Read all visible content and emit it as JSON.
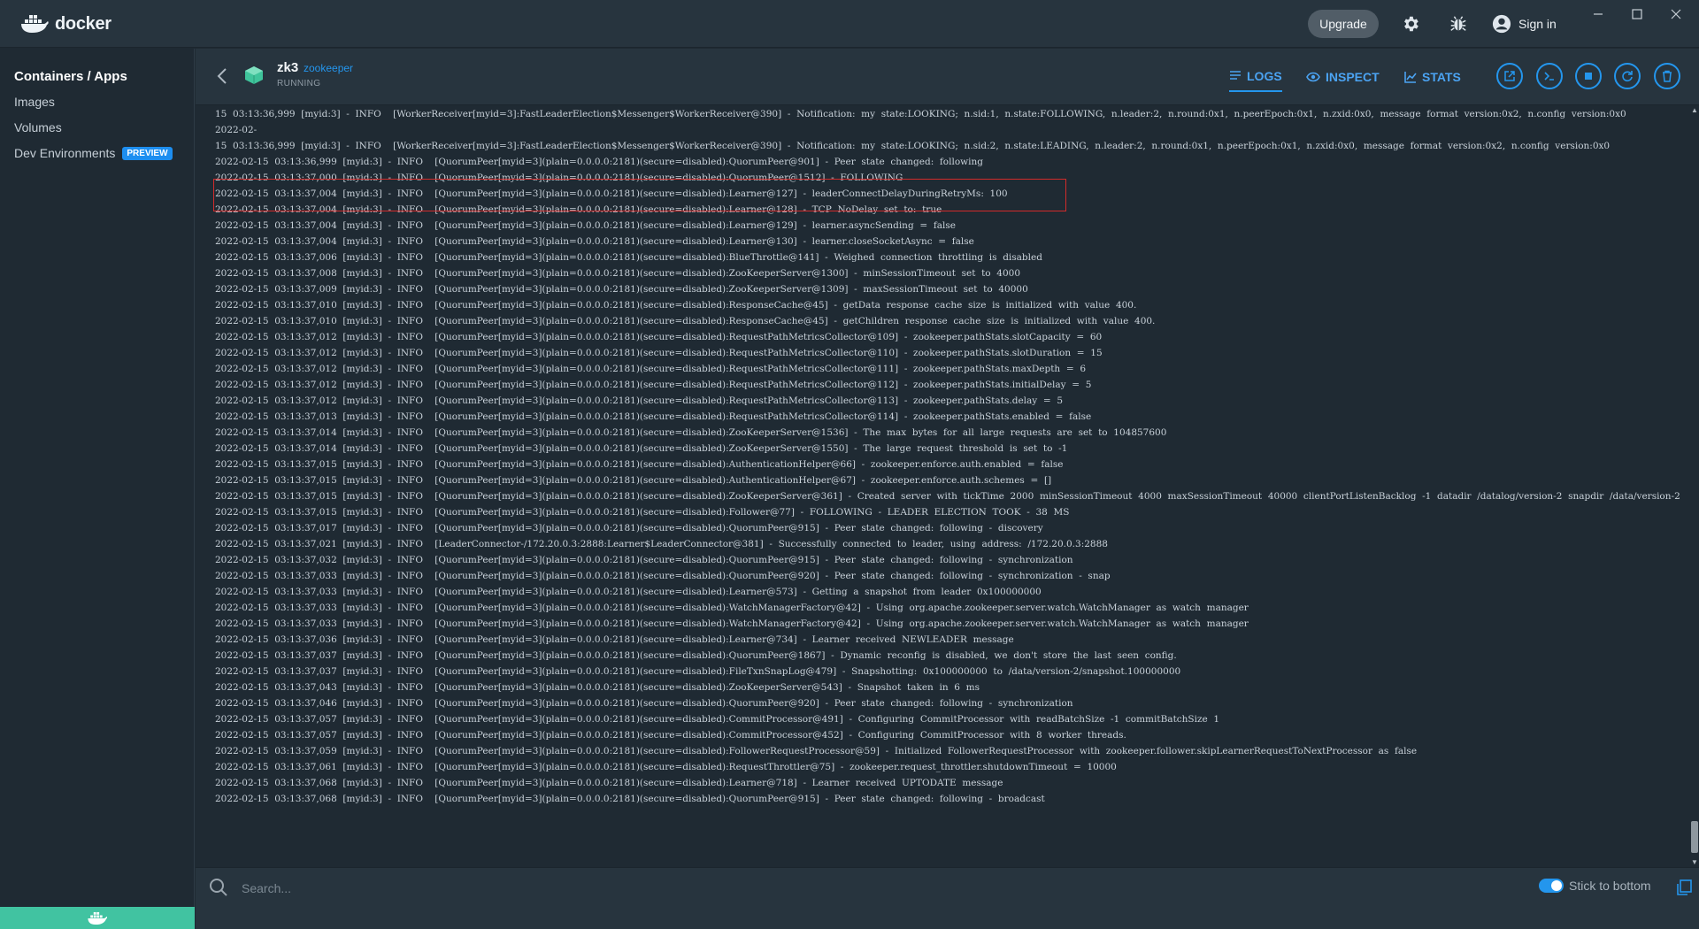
{
  "app": {
    "name": "docker"
  },
  "topbar": {
    "upgrade_label": "Upgrade",
    "settings_icon": "gear-icon",
    "bug_icon": "bug-icon",
    "signin_label": "Sign in",
    "window_controls": [
      "minimize",
      "maximize",
      "close"
    ]
  },
  "sidebar": {
    "items": [
      {
        "label": "Containers / Apps",
        "active": true
      },
      {
        "label": "Images"
      },
      {
        "label": "Volumes"
      },
      {
        "label": "Dev Environments",
        "badge": "PREVIEW"
      }
    ]
  },
  "container": {
    "name": "zk3",
    "image": "zookeeper",
    "status": "RUNNING"
  },
  "tabs": [
    {
      "label": "LOGS",
      "icon": "list-icon",
      "active": true
    },
    {
      "label": "INSPECT",
      "icon": "eye-icon"
    },
    {
      "label": "STATS",
      "icon": "chart-icon"
    }
  ],
  "actions": [
    "open-in-browser",
    "cli",
    "stop",
    "restart",
    "delete"
  ],
  "logs": [
    "15  03:13:36,999  [myid:3]  -  INFO    [WorkerReceiver[myid=3]:FastLeaderElection$Messenger$WorkerReceiver@390]  -  Notification:  my  state:LOOKING;  n.sid:1,  n.state:FOLLOWING,  n.leader:2,  n.round:0x1,  n.peerEpoch:0x1,  n.zxid:0x0,  message  format  version:0x2,  n.config  version:0x0",
    "2022-02-",
    "15  03:13:36,999  [myid:3]  -  INFO    [WorkerReceiver[myid=3]:FastLeaderElection$Messenger$WorkerReceiver@390]  -  Notification:  my  state:LOOKING;  n.sid:2,  n.state:LEADING,  n.leader:2,  n.round:0x1,  n.peerEpoch:0x1,  n.zxid:0x0,  message  format  version:0x2,  n.config  version:0x0",
    "2022-02-15  03:13:36,999  [myid:3]  -  INFO    [QuorumPeer[myid=3](plain=0.0.0.0:2181)(secure=disabled):QuorumPeer@901]  -  Peer  state  changed:  following",
    "2022-02-15  03:13:37,000  [myid:3]  -  INFO    [QuorumPeer[myid=3](plain=0.0.0.0:2181)(secure=disabled):QuorumPeer@1512]  -  FOLLOWING",
    "2022-02-15  03:13:37,004  [myid:3]  -  INFO    [QuorumPeer[myid=3](plain=0.0.0.0:2181)(secure=disabled):Learner@127]  -  leaderConnectDelayDuringRetryMs:  100",
    "2022-02-15  03:13:37,004  [myid:3]  -  INFO    [QuorumPeer[myid=3](plain=0.0.0.0:2181)(secure=disabled):Learner@128]  -  TCP  NoDelay  set  to:  true",
    "2022-02-15  03:13:37,004  [myid:3]  -  INFO    [QuorumPeer[myid=3](plain=0.0.0.0:2181)(secure=disabled):Learner@129]  -  learner.asyncSending  =  false",
    "2022-02-15  03:13:37,004  [myid:3]  -  INFO    [QuorumPeer[myid=3](plain=0.0.0.0:2181)(secure=disabled):Learner@130]  -  learner.closeSocketAsync  =  false",
    "2022-02-15  03:13:37,006  [myid:3]  -  INFO    [QuorumPeer[myid=3](plain=0.0.0.0:2181)(secure=disabled):BlueThrottle@141]  -  Weighed  connection  throttling  is  disabled",
    "2022-02-15  03:13:37,008  [myid:3]  -  INFO    [QuorumPeer[myid=3](plain=0.0.0.0:2181)(secure=disabled):ZooKeeperServer@1300]  -  minSessionTimeout  set  to  4000",
    "2022-02-15  03:13:37,009  [myid:3]  -  INFO    [QuorumPeer[myid=3](plain=0.0.0.0:2181)(secure=disabled):ZooKeeperServer@1309]  -  maxSessionTimeout  set  to  40000",
    "2022-02-15  03:13:37,010  [myid:3]  -  INFO    [QuorumPeer[myid=3](plain=0.0.0.0:2181)(secure=disabled):ResponseCache@45]  -  getData  response  cache  size  is  initialized  with  value  400.",
    "2022-02-15  03:13:37,010  [myid:3]  -  INFO    [QuorumPeer[myid=3](plain=0.0.0.0:2181)(secure=disabled):ResponseCache@45]  -  getChildren  response  cache  size  is  initialized  with  value  400.",
    "2022-02-15  03:13:37,012  [myid:3]  -  INFO    [QuorumPeer[myid=3](plain=0.0.0.0:2181)(secure=disabled):RequestPathMetricsCollector@109]  -  zookeeper.pathStats.slotCapacity  =  60",
    "2022-02-15  03:13:37,012  [myid:3]  -  INFO    [QuorumPeer[myid=3](plain=0.0.0.0:2181)(secure=disabled):RequestPathMetricsCollector@110]  -  zookeeper.pathStats.slotDuration  =  15",
    "2022-02-15  03:13:37,012  [myid:3]  -  INFO    [QuorumPeer[myid=3](plain=0.0.0.0:2181)(secure=disabled):RequestPathMetricsCollector@111]  -  zookeeper.pathStats.maxDepth  =  6",
    "2022-02-15  03:13:37,012  [myid:3]  -  INFO    [QuorumPeer[myid=3](plain=0.0.0.0:2181)(secure=disabled):RequestPathMetricsCollector@112]  -  zookeeper.pathStats.initialDelay  =  5",
    "2022-02-15  03:13:37,012  [myid:3]  -  INFO    [QuorumPeer[myid=3](plain=0.0.0.0:2181)(secure=disabled):RequestPathMetricsCollector@113]  -  zookeeper.pathStats.delay  =  5",
    "2022-02-15  03:13:37,013  [myid:3]  -  INFO    [QuorumPeer[myid=3](plain=0.0.0.0:2181)(secure=disabled):RequestPathMetricsCollector@114]  -  zookeeper.pathStats.enabled  =  false",
    "2022-02-15  03:13:37,014  [myid:3]  -  INFO    [QuorumPeer[myid=3](plain=0.0.0.0:2181)(secure=disabled):ZooKeeperServer@1536]  -  The  max  bytes  for  all  large  requests  are  set  to  104857600",
    "2022-02-15  03:13:37,014  [myid:3]  -  INFO    [QuorumPeer[myid=3](plain=0.0.0.0:2181)(secure=disabled):ZooKeeperServer@1550]  -  The  large  request  threshold  is  set  to  -1",
    "2022-02-15  03:13:37,015  [myid:3]  -  INFO    [QuorumPeer[myid=3](plain=0.0.0.0:2181)(secure=disabled):AuthenticationHelper@66]  -  zookeeper.enforce.auth.enabled  =  false",
    "2022-02-15  03:13:37,015  [myid:3]  -  INFO    [QuorumPeer[myid=3](plain=0.0.0.0:2181)(secure=disabled):AuthenticationHelper@67]  -  zookeeper.enforce.auth.schemes  =  []",
    "2022-02-15  03:13:37,015  [myid:3]  -  INFO    [QuorumPeer[myid=3](plain=0.0.0.0:2181)(secure=disabled):ZooKeeperServer@361]  -  Created  server  with  tickTime  2000  minSessionTimeout  4000  maxSessionTimeout  40000  clientPortListenBacklog  -1  datadir  /datalog/version-2  snapdir  /data/version-2",
    "2022-02-15  03:13:37,015  [myid:3]  -  INFO    [QuorumPeer[myid=3](plain=0.0.0.0:2181)(secure=disabled):Follower@77]  -  FOLLOWING  -  LEADER  ELECTION  TOOK  -  38  MS",
    "2022-02-15  03:13:37,017  [myid:3]  -  INFO    [QuorumPeer[myid=3](plain=0.0.0.0:2181)(secure=disabled):QuorumPeer@915]  -  Peer  state  changed:  following  -  discovery",
    "2022-02-15  03:13:37,021  [myid:3]  -  INFO    [LeaderConnector-/172.20.0.3:2888:Learner$LeaderConnector@381]  -  Successfully  connected  to  leader,  using  address:  /172.20.0.3:2888",
    "2022-02-15  03:13:37,032  [myid:3]  -  INFO    [QuorumPeer[myid=3](plain=0.0.0.0:2181)(secure=disabled):QuorumPeer@915]  -  Peer  state  changed:  following  -  synchronization",
    "2022-02-15  03:13:37,033  [myid:3]  -  INFO    [QuorumPeer[myid=3](plain=0.0.0.0:2181)(secure=disabled):QuorumPeer@920]  -  Peer  state  changed:  following  -  synchronization  -  snap",
    "2022-02-15  03:13:37,033  [myid:3]  -  INFO    [QuorumPeer[myid=3](plain=0.0.0.0:2181)(secure=disabled):Learner@573]  -  Getting  a  snapshot  from  leader  0x100000000",
    "2022-02-15  03:13:37,033  [myid:3]  -  INFO    [QuorumPeer[myid=3](plain=0.0.0.0:2181)(secure=disabled):WatchManagerFactory@42]  -  Using  org.apache.zookeeper.server.watch.WatchManager  as  watch  manager",
    "2022-02-15  03:13:37,033  [myid:3]  -  INFO    [QuorumPeer[myid=3](plain=0.0.0.0:2181)(secure=disabled):WatchManagerFactory@42]  -  Using  org.apache.zookeeper.server.watch.WatchManager  as  watch  manager",
    "2022-02-15  03:13:37,036  [myid:3]  -  INFO    [QuorumPeer[myid=3](plain=0.0.0.0:2181)(secure=disabled):Learner@734]  -  Learner  received  NEWLEADER  message",
    "2022-02-15  03:13:37,037  [myid:3]  -  INFO    [QuorumPeer[myid=3](plain=0.0.0.0:2181)(secure=disabled):QuorumPeer@1867]  -  Dynamic  reconfig  is  disabled,  we  don't  store  the  last  seen  config.",
    "2022-02-15  03:13:37,037  [myid:3]  -  INFO    [QuorumPeer[myid=3](plain=0.0.0.0:2181)(secure=disabled):FileTxnSnapLog@479]  -  Snapshotting:  0x100000000  to  /data/version-2/snapshot.100000000",
    "2022-02-15  03:13:37,043  [myid:3]  -  INFO    [QuorumPeer[myid=3](plain=0.0.0.0:2181)(secure=disabled):ZooKeeperServer@543]  -  Snapshot  taken  in  6  ms",
    "2022-02-15  03:13:37,046  [myid:3]  -  INFO    [QuorumPeer[myid=3](plain=0.0.0.0:2181)(secure=disabled):QuorumPeer@920]  -  Peer  state  changed:  following  -  synchronization",
    "2022-02-15  03:13:37,057  [myid:3]  -  INFO    [QuorumPeer[myid=3](plain=0.0.0.0:2181)(secure=disabled):CommitProcessor@491]  -  Configuring  CommitProcessor  with  readBatchSize  -1  commitBatchSize  1",
    "2022-02-15  03:13:37,057  [myid:3]  -  INFO    [QuorumPeer[myid=3](plain=0.0.0.0:2181)(secure=disabled):CommitProcessor@452]  -  Configuring  CommitProcessor  with  8  worker  threads.",
    "2022-02-15  03:13:37,059  [myid:3]  -  INFO    [QuorumPeer[myid=3](plain=0.0.0.0:2181)(secure=disabled):FollowerRequestProcessor@59]  -  Initialized  FollowerRequestProcessor  with  zookeeper.follower.skipLearnerRequestToNextProcessor  as  false",
    "2022-02-15  03:13:37,061  [myid:3]  -  INFO    [QuorumPeer[myid=3](plain=0.0.0.0:2181)(secure=disabled):RequestThrottler@75]  -  zookeeper.request_throttler.shutdownTimeout  =  10000",
    "2022-02-15  03:13:37,068  [myid:3]  -  INFO    [QuorumPeer[myid=3](plain=0.0.0.0:2181)(secure=disabled):Learner@718]  -  Learner  received  UPTODATE  message",
    "2022-02-15  03:13:37,068  [myid:3]  -  INFO    [QuorumPeer[myid=3](plain=0.0.0.0:2181)(secure=disabled):QuorumPeer@915]  -  Peer  state  changed:  following  -  broadcast"
  ],
  "search": {
    "placeholder": "Search..."
  },
  "stick_to_bottom": {
    "label": "Stick to bottom",
    "enabled": true
  },
  "colors": {
    "accent": "#2496ed",
    "highlight_border": "#d22b2b",
    "whale_bar": "#41c3a1"
  }
}
